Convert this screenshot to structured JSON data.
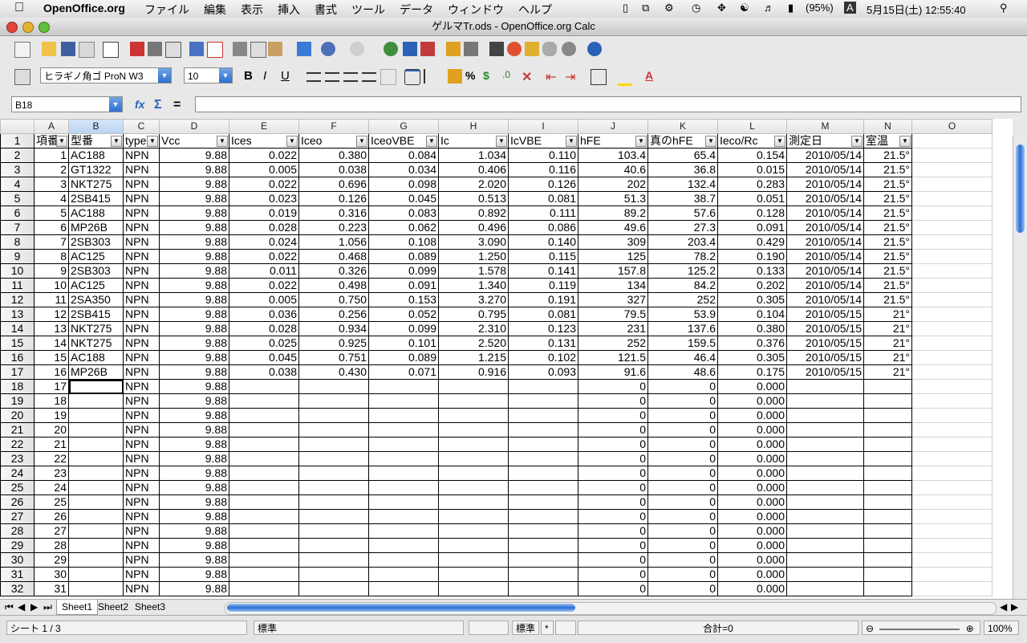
{
  "menubar": {
    "app_name": "OpenOffice.org",
    "items": [
      "ファイル",
      "編集",
      "表示",
      "挿入",
      "書式",
      "ツール",
      "データ",
      "ウィンドウ",
      "ヘルプ"
    ],
    "battery": "(95%)",
    "clock": "5月15日(土)  12:55:40",
    "input_menu": "A"
  },
  "window": {
    "title": "ゲルマTr.ods - OpenOffice.org Calc"
  },
  "format": {
    "font_name": "ヒラギノ角ゴ ProN W3",
    "font_size": "10"
  },
  "formula": {
    "cell_ref": "B18",
    "content": ""
  },
  "columns": [
    "A",
    "B",
    "C",
    "D",
    "E",
    "F",
    "G",
    "H",
    "I",
    "J",
    "K",
    "L",
    "M",
    "N",
    "O"
  ],
  "header_row": [
    "項番",
    "型番",
    "type",
    "Vcc",
    "Ices",
    "Iceo",
    "IceoVBE",
    "Ic",
    "IcVBE",
    "hFE",
    "真のhFE",
    "Ieco/Rc",
    "測定日",
    "室温"
  ],
  "rows": [
    [
      "1",
      "AC188",
      "NPN",
      "9.88",
      "0.022",
      "0.380",
      "0.084",
      "1.034",
      "0.110",
      "103.4",
      "65.4",
      "0.154",
      "2010/05/14",
      "21.5°"
    ],
    [
      "2",
      "GT1322",
      "NPN",
      "9.88",
      "0.005",
      "0.038",
      "0.034",
      "0.406",
      "0.116",
      "40.6",
      "36.8",
      "0.015",
      "2010/05/14",
      "21.5°"
    ],
    [
      "3",
      "NKT275",
      "NPN",
      "9.88",
      "0.022",
      "0.696",
      "0.098",
      "2.020",
      "0.126",
      "202",
      "132.4",
      "0.283",
      "2010/05/14",
      "21.5°"
    ],
    [
      "4",
      "2SB415",
      "NPN",
      "9.88",
      "0.023",
      "0.126",
      "0.045",
      "0.513",
      "0.081",
      "51.3",
      "38.7",
      "0.051",
      "2010/05/14",
      "21.5°"
    ],
    [
      "5",
      "AC188",
      "NPN",
      "9.88",
      "0.019",
      "0.316",
      "0.083",
      "0.892",
      "0.111",
      "89.2",
      "57.6",
      "0.128",
      "2010/05/14",
      "21.5°"
    ],
    [
      "6",
      "MP26B",
      "NPN",
      "9.88",
      "0.028",
      "0.223",
      "0.062",
      "0.496",
      "0.086",
      "49.6",
      "27.3",
      "0.091",
      "2010/05/14",
      "21.5°"
    ],
    [
      "7",
      "2SB303",
      "NPN",
      "9.88",
      "0.024",
      "1.056",
      "0.108",
      "3.090",
      "0.140",
      "309",
      "203.4",
      "0.429",
      "2010/05/14",
      "21.5°"
    ],
    [
      "8",
      "AC125",
      "NPN",
      "9.88",
      "0.022",
      "0.468",
      "0.089",
      "1.250",
      "0.115",
      "125",
      "78.2",
      "0.190",
      "2010/05/14",
      "21.5°"
    ],
    [
      "9",
      "2SB303",
      "NPN",
      "9.88",
      "0.011",
      "0.326",
      "0.099",
      "1.578",
      "0.141",
      "157.8",
      "125.2",
      "0.133",
      "2010/05/14",
      "21.5°"
    ],
    [
      "10",
      "AC125",
      "NPN",
      "9.88",
      "0.022",
      "0.498",
      "0.091",
      "1.340",
      "0.119",
      "134",
      "84.2",
      "0.202",
      "2010/05/14",
      "21.5°"
    ],
    [
      "11",
      "2SA350",
      "NPN",
      "9.88",
      "0.005",
      "0.750",
      "0.153",
      "3.270",
      "0.191",
      "327",
      "252",
      "0.305",
      "2010/05/14",
      "21.5°"
    ],
    [
      "12",
      "2SB415",
      "NPN",
      "9.88",
      "0.036",
      "0.256",
      "0.052",
      "0.795",
      "0.081",
      "79.5",
      "53.9",
      "0.104",
      "2010/05/15",
      "21°"
    ],
    [
      "13",
      "NKT275",
      "NPN",
      "9.88",
      "0.028",
      "0.934",
      "0.099",
      "2.310",
      "0.123",
      "231",
      "137.6",
      "0.380",
      "2010/05/15",
      "21°"
    ],
    [
      "14",
      "NKT275",
      "NPN",
      "9.88",
      "0.025",
      "0.925",
      "0.101",
      "2.520",
      "0.131",
      "252",
      "159.5",
      "0.376",
      "2010/05/15",
      "21°"
    ],
    [
      "15",
      "AC188",
      "NPN",
      "9.88",
      "0.045",
      "0.751",
      "0.089",
      "1.215",
      "0.102",
      "121.5",
      "46.4",
      "0.305",
      "2010/05/15",
      "21°"
    ],
    [
      "16",
      "MP26B",
      "NPN",
      "9.88",
      "0.038",
      "0.430",
      "0.071",
      "0.916",
      "0.093",
      "91.6",
      "48.6",
      "0.175",
      "2010/05/15",
      "21°"
    ],
    [
      "17",
      "",
      "NPN",
      "9.88",
      "",
      "",
      "",
      "",
      "",
      "0",
      "0",
      "0.000",
      "",
      ""
    ],
    [
      "18",
      "",
      "NPN",
      "9.88",
      "",
      "",
      "",
      "",
      "",
      "0",
      "0",
      "0.000",
      "",
      ""
    ],
    [
      "19",
      "",
      "NPN",
      "9.88",
      "",
      "",
      "",
      "",
      "",
      "0",
      "0",
      "0.000",
      "",
      ""
    ],
    [
      "20",
      "",
      "NPN",
      "9.88",
      "",
      "",
      "",
      "",
      "",
      "0",
      "0",
      "0.000",
      "",
      ""
    ],
    [
      "21",
      "",
      "NPN",
      "9.88",
      "",
      "",
      "",
      "",
      "",
      "0",
      "0",
      "0.000",
      "",
      ""
    ],
    [
      "22",
      "",
      "NPN",
      "9.88",
      "",
      "",
      "",
      "",
      "",
      "0",
      "0",
      "0.000",
      "",
      ""
    ],
    [
      "23",
      "",
      "NPN",
      "9.88",
      "",
      "",
      "",
      "",
      "",
      "0",
      "0",
      "0.000",
      "",
      ""
    ],
    [
      "24",
      "",
      "NPN",
      "9.88",
      "",
      "",
      "",
      "",
      "",
      "0",
      "0",
      "0.000",
      "",
      ""
    ],
    [
      "25",
      "",
      "NPN",
      "9.88",
      "",
      "",
      "",
      "",
      "",
      "0",
      "0",
      "0.000",
      "",
      ""
    ],
    [
      "26",
      "",
      "NPN",
      "9.88",
      "",
      "",
      "",
      "",
      "",
      "0",
      "0",
      "0.000",
      "",
      ""
    ],
    [
      "27",
      "",
      "NPN",
      "9.88",
      "",
      "",
      "",
      "",
      "",
      "0",
      "0",
      "0.000",
      "",
      ""
    ],
    [
      "28",
      "",
      "NPN",
      "9.88",
      "",
      "",
      "",
      "",
      "",
      "0",
      "0",
      "0.000",
      "",
      ""
    ],
    [
      "29",
      "",
      "NPN",
      "9.88",
      "",
      "",
      "",
      "",
      "",
      "0",
      "0",
      "0.000",
      "",
      ""
    ],
    [
      "30",
      "",
      "NPN",
      "9.88",
      "",
      "",
      "",
      "",
      "",
      "0",
      "0",
      "0.000",
      "",
      ""
    ],
    [
      "31",
      "",
      "NPN",
      "9.88",
      "",
      "",
      "",
      "",
      "",
      "0",
      "0",
      "0.000",
      "",
      ""
    ]
  ],
  "sheets": [
    "Sheet1",
    "Sheet2",
    "Sheet3"
  ],
  "status": {
    "sheet_pos": "シート 1 / 3",
    "page_style": "標準",
    "mode": "標準",
    "modified": "*",
    "sum": "合計=0",
    "zoom": "100%"
  },
  "colors": {
    "accent": "#2c6dd2",
    "selected_header": "#b9d2f3"
  }
}
